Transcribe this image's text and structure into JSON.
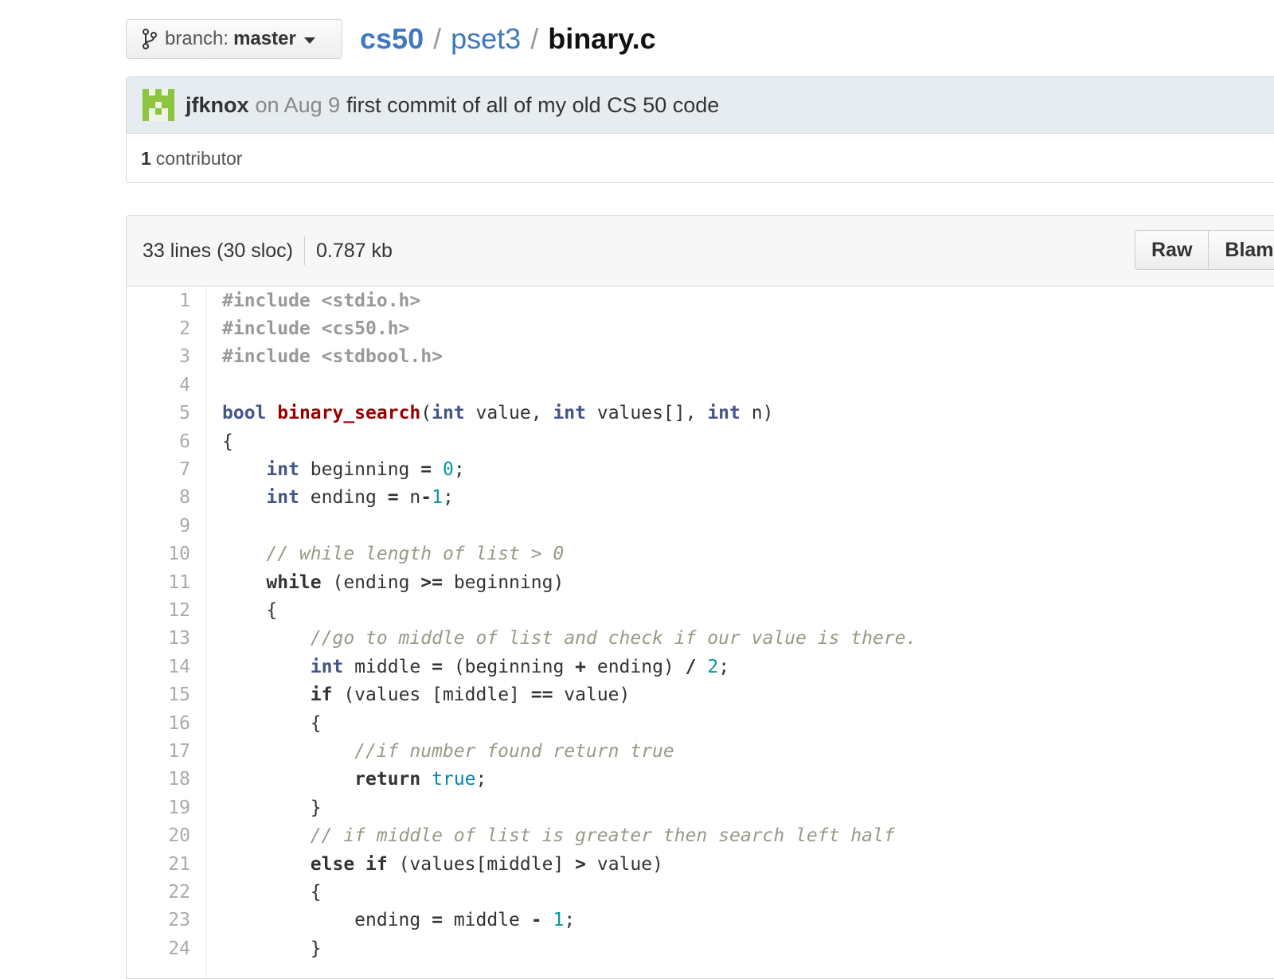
{
  "branch": {
    "label": "branch:",
    "name": "master"
  },
  "breadcrumb": {
    "repo": "cs50",
    "sep": "/",
    "folder": "pset3",
    "file": "binary.c"
  },
  "commit": {
    "author": "jfknox",
    "date": "on Aug 9",
    "message": "first commit of all of my old CS 50 code",
    "contributors_count": "1",
    "contributors_label": "contributor"
  },
  "file": {
    "lines_info": "33 lines (30 sloc)",
    "size": "0.787 kb",
    "buttons": {
      "raw": "Raw",
      "blame": "Blame"
    }
  },
  "colors": {
    "link": "#4078c0",
    "commit_bg": "#e6ecef",
    "type": "#445588",
    "function": "#990000",
    "number": "#009999",
    "constant": "#0086b3",
    "comment": "#999988",
    "preprocessor": "#999999",
    "avatar": "#8cc63e"
  },
  "code_lines": [
    {
      "n": "1",
      "tokens": [
        [
          "pre",
          "#include <stdio.h>"
        ]
      ]
    },
    {
      "n": "2",
      "tokens": [
        [
          "pre",
          "#include <cs50.h>"
        ]
      ]
    },
    {
      "n": "3",
      "tokens": [
        [
          "pre",
          "#include <stdbool.h>"
        ]
      ]
    },
    {
      "n": "4",
      "tokens": []
    },
    {
      "n": "5",
      "tokens": [
        [
          "type",
          "bool"
        ],
        [
          "plain",
          " "
        ],
        [
          "func",
          "binary_search"
        ],
        [
          "plain",
          "("
        ],
        [
          "type",
          "int"
        ],
        [
          "plain",
          " value, "
        ],
        [
          "type",
          "int"
        ],
        [
          "plain",
          " values[], "
        ],
        [
          "type",
          "int"
        ],
        [
          "plain",
          " n)"
        ]
      ]
    },
    {
      "n": "6",
      "tokens": [
        [
          "plain",
          "{"
        ]
      ]
    },
    {
      "n": "7",
      "tokens": [
        [
          "plain",
          "    "
        ],
        [
          "type",
          "int"
        ],
        [
          "plain",
          " beginning "
        ],
        [
          "op",
          "="
        ],
        [
          "plain",
          " "
        ],
        [
          "num",
          "0"
        ],
        [
          "plain",
          ";"
        ]
      ]
    },
    {
      "n": "8",
      "tokens": [
        [
          "plain",
          "    "
        ],
        [
          "type",
          "int"
        ],
        [
          "plain",
          " ending "
        ],
        [
          "op",
          "="
        ],
        [
          "plain",
          " n"
        ],
        [
          "op",
          "-"
        ],
        [
          "num",
          "1"
        ],
        [
          "plain",
          ";"
        ]
      ]
    },
    {
      "n": "9",
      "tokens": []
    },
    {
      "n": "10",
      "tokens": [
        [
          "plain",
          "    "
        ],
        [
          "cmt",
          "// while length of list > 0"
        ]
      ]
    },
    {
      "n": "11",
      "tokens": [
        [
          "plain",
          "    "
        ],
        [
          "kw",
          "while"
        ],
        [
          "plain",
          " (ending "
        ],
        [
          "op",
          ">="
        ],
        [
          "plain",
          " beginning)"
        ]
      ]
    },
    {
      "n": "12",
      "tokens": [
        [
          "plain",
          "    {"
        ]
      ]
    },
    {
      "n": "13",
      "tokens": [
        [
          "plain",
          "        "
        ],
        [
          "cmt",
          "//go to middle of list and check if our value is there."
        ]
      ]
    },
    {
      "n": "14",
      "tokens": [
        [
          "plain",
          "        "
        ],
        [
          "type",
          "int"
        ],
        [
          "plain",
          " middle "
        ],
        [
          "op",
          "="
        ],
        [
          "plain",
          " (beginning "
        ],
        [
          "op",
          "+"
        ],
        [
          "plain",
          " ending) "
        ],
        [
          "op",
          "/"
        ],
        [
          "plain",
          " "
        ],
        [
          "num",
          "2"
        ],
        [
          "plain",
          ";"
        ]
      ]
    },
    {
      "n": "15",
      "tokens": [
        [
          "plain",
          "        "
        ],
        [
          "kw",
          "if"
        ],
        [
          "plain",
          " (values [middle] "
        ],
        [
          "op",
          "=="
        ],
        [
          "plain",
          " value)"
        ]
      ]
    },
    {
      "n": "16",
      "tokens": [
        [
          "plain",
          "        {"
        ]
      ]
    },
    {
      "n": "17",
      "tokens": [
        [
          "plain",
          "            "
        ],
        [
          "cmt",
          "//if number found return true"
        ]
      ]
    },
    {
      "n": "18",
      "tokens": [
        [
          "plain",
          "            "
        ],
        [
          "kw",
          "return"
        ],
        [
          "plain",
          " "
        ],
        [
          "const",
          "true"
        ],
        [
          "plain",
          ";"
        ]
      ]
    },
    {
      "n": "19",
      "tokens": [
        [
          "plain",
          "        }"
        ]
      ]
    },
    {
      "n": "20",
      "tokens": [
        [
          "plain",
          "        "
        ],
        [
          "cmt",
          "// if middle of list is greater then search left half"
        ]
      ]
    },
    {
      "n": "21",
      "tokens": [
        [
          "plain",
          "        "
        ],
        [
          "kw",
          "else"
        ],
        [
          "plain",
          " "
        ],
        [
          "kw",
          "if"
        ],
        [
          "plain",
          " (values[middle] "
        ],
        [
          "op",
          ">"
        ],
        [
          "plain",
          " value)"
        ]
      ]
    },
    {
      "n": "22",
      "tokens": [
        [
          "plain",
          "        {"
        ]
      ]
    },
    {
      "n": "23",
      "tokens": [
        [
          "plain",
          "            ending "
        ],
        [
          "op",
          "="
        ],
        [
          "plain",
          " middle "
        ],
        [
          "op",
          "-"
        ],
        [
          "plain",
          " "
        ],
        [
          "num",
          "1"
        ],
        [
          "plain",
          ";"
        ]
      ]
    },
    {
      "n": "24",
      "tokens": [
        [
          "plain",
          "        }"
        ]
      ]
    }
  ]
}
